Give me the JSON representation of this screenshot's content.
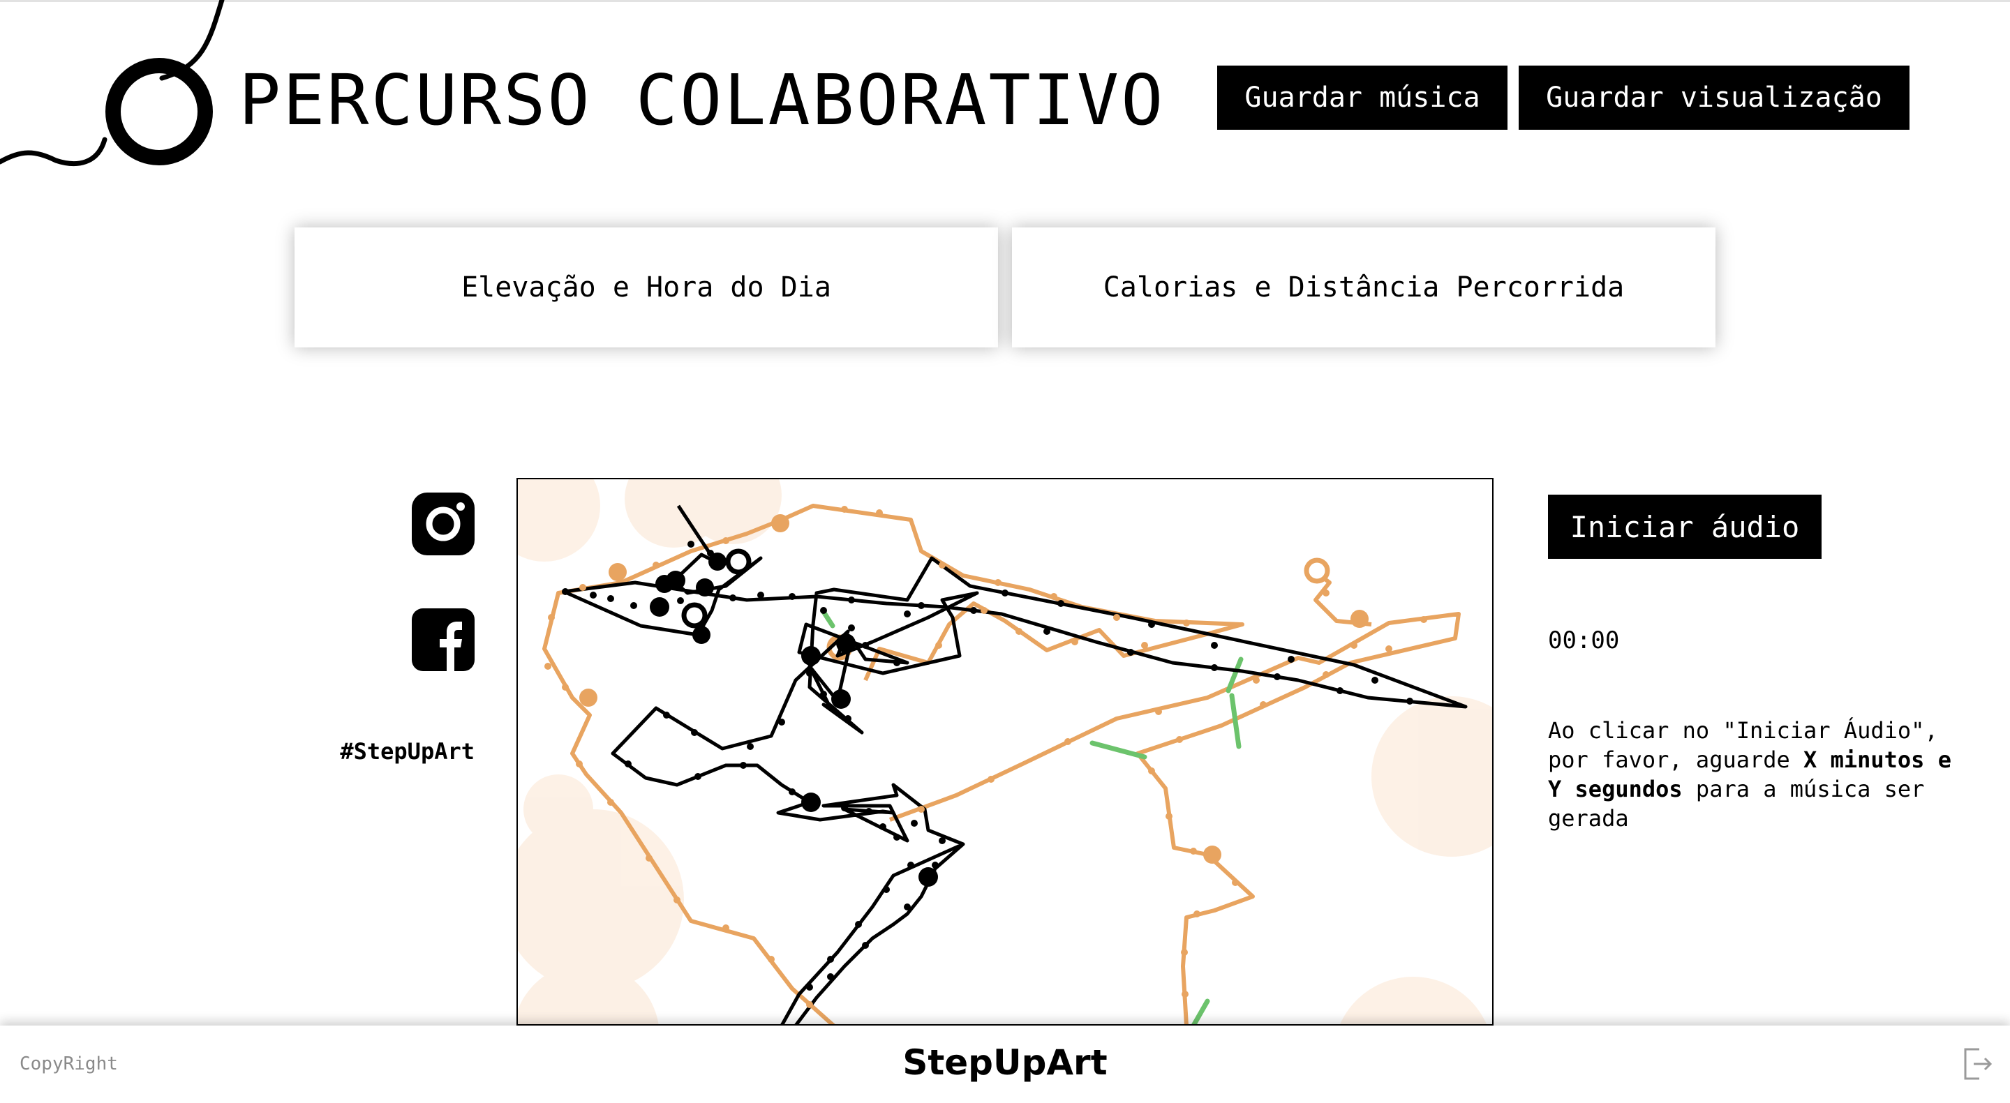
{
  "header": {
    "title": "PERCURSO COLABORATIVO",
    "save_music_label": "Guardar música",
    "save_visualization_label": "Guardar visualização"
  },
  "tabs": [
    {
      "label": "Elevação e Hora do Dia"
    },
    {
      "label": "Calorias e Distância Percorrida"
    }
  ],
  "social": {
    "icons": [
      "instagram-icon",
      "facebook-icon"
    ],
    "hashtag": "#StepUpArt"
  },
  "player": {
    "start_audio_label": "Iniciar áudio",
    "timer": "00:00",
    "info_prefix": "Ao clicar no \"Iniciar Áudio\", por favor, aguarde ",
    "info_bold1": "X minutos",
    "info_mid": " e ",
    "info_bold2": "Y segundos",
    "info_suffix": " para a música ser gerada"
  },
  "footer": {
    "copyright": "CopyRight",
    "brand": "StepUpArt",
    "logout_icon": "logout-icon"
  },
  "colors": {
    "accent_orange": "#e8a460",
    "circle_fill": "#fbe3cd",
    "route_black": "#000000",
    "marker_green": "#6cc36c",
    "button_bg": "#000000"
  }
}
